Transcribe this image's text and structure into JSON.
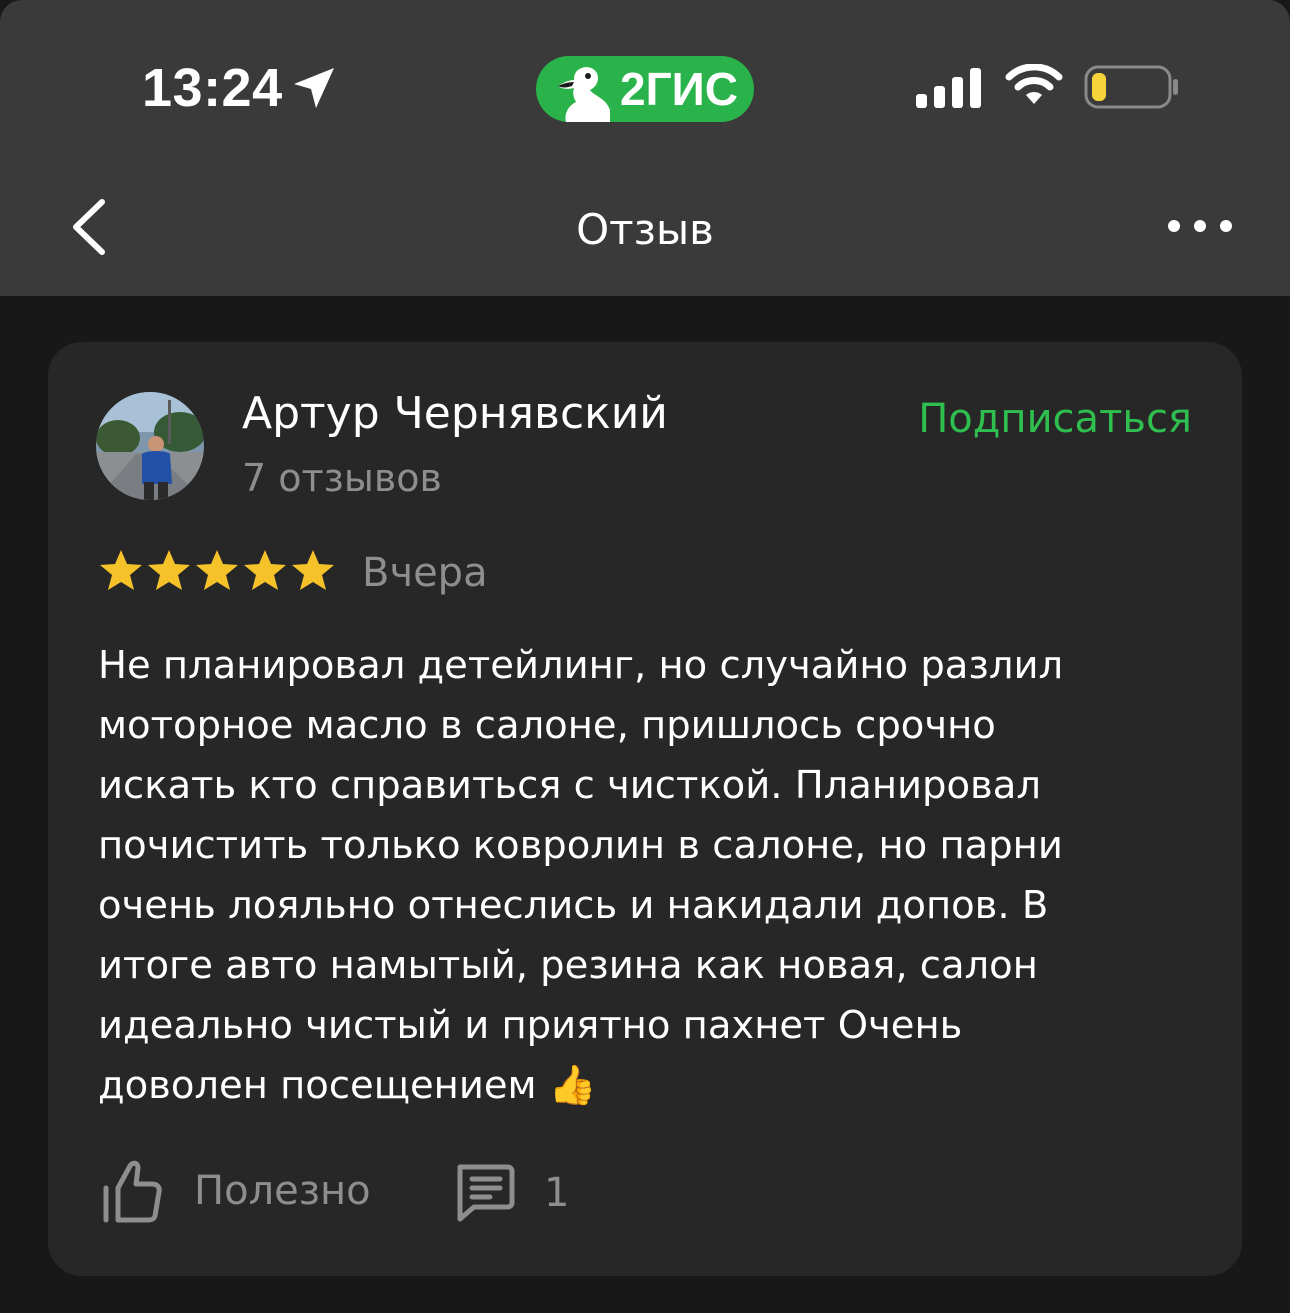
{
  "status_bar": {
    "time": "13:24",
    "brand": "2ГИС",
    "icons": [
      "location-arrow-icon",
      "signal-icon",
      "wifi-icon",
      "battery-low-icon"
    ]
  },
  "header": {
    "title": "Отзыв",
    "back_icon": "chevron-left-icon",
    "more_icon": "more-dots-icon"
  },
  "review": {
    "author": {
      "name": "Артур Чернявский",
      "reviews_count": "7 отзывов",
      "avatar": "user-photo"
    },
    "subscribe_label": "Подписаться",
    "rating": 5,
    "rating_max": 5,
    "date": "Вчера",
    "text": "Не планировал детейлинг, но случайно разлил\nмоторное масло в салоне, пришлось срочно\nискать кто справиться с чисткой. Планировал\nпочистить только ковролин в салоне, но парни\nочень лояльно отнеслись и накидали допов. В\nитоге авто намытый, резина как новая, салон\nидеально чистый и приятно пахнет Очень\nдоволен посещением 👍",
    "actions": {
      "like_label": "Полезно",
      "comments_count": "1"
    }
  },
  "colors": {
    "background": "#181818",
    "topbar": "#3a3a3a",
    "card": "#272727",
    "accent_green": "#2fbf4f",
    "brand_green": "#29b34a",
    "star_yellow": "#f6c22a",
    "muted_text": "#8e8e8e"
  }
}
